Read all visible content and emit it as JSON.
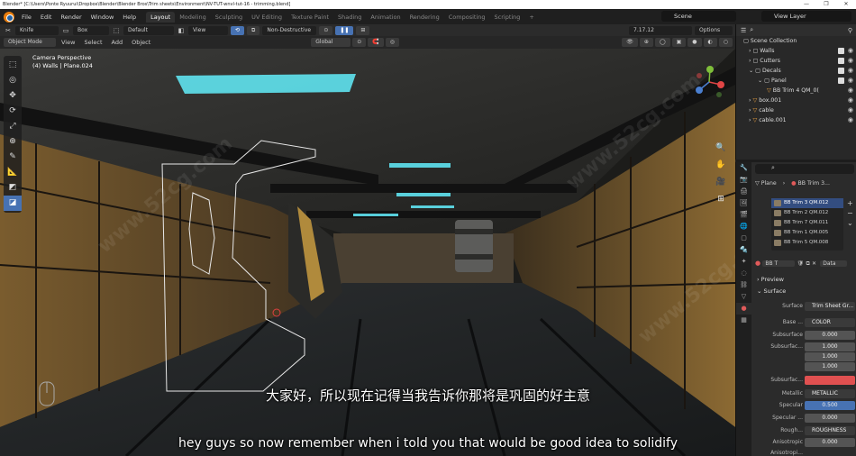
{
  "window": {
    "title": "Blender* [C:\\Users\\Ponte Ryuurui\\Dropbox\\Blender\\Blender Bros\\Trim sheets\\Environment\\NV-TUT-wnvl-tut-16 - trimming.blend]",
    "controls": [
      "—",
      "❐",
      "✕"
    ]
  },
  "topbar": {
    "menus": [
      "File",
      "Edit",
      "Render",
      "Window",
      "Help"
    ],
    "workspaces": [
      "Layout",
      "Modeling",
      "Sculpting",
      "UV Editing",
      "Texture Paint",
      "Shading",
      "Animation",
      "Rendering",
      "Compositing",
      "Scripting",
      "+"
    ],
    "active_workspace": "Layout",
    "scene": "Scene",
    "view_layer": "View Layer"
  },
  "tool_header": {
    "tool_name": "Knife",
    "shape": "Box",
    "mode_a": "Default",
    "view": "View",
    "mode_b": "Non-Destructive",
    "version": "7.17.12",
    "options": "Options"
  },
  "viewport_header": {
    "mode": "Object Mode",
    "menus": [
      "View",
      "Select",
      "Add",
      "Object"
    ],
    "orientation": "Global"
  },
  "viewport": {
    "camera": "Camera Perspective",
    "object": "(4) Walls | Plane.024",
    "watermarks": [
      "www.52cg.com",
      "www.52cg.com",
      "www.52cg.com"
    ]
  },
  "subtitles": {
    "cn": "大家好，所以现在记得当我告诉你那将是巩固的好主意",
    "en": "hey guys so now remember when i told you that would be good idea to solidify"
  },
  "outliner": {
    "rows": [
      {
        "label": "Scene Collection",
        "indent": 0
      },
      {
        "label": "Walls",
        "indent": 1
      },
      {
        "label": "Cutters",
        "indent": 1
      },
      {
        "label": "Decals",
        "indent": 1
      },
      {
        "label": "Panel",
        "indent": 2
      },
      {
        "label": "BB Trim 4 QM_0(",
        "indent": 3
      },
      {
        "label": "box.001",
        "indent": 1
      },
      {
        "label": "cable",
        "indent": 1
      },
      {
        "label": "cable.001",
        "indent": 1
      }
    ]
  },
  "properties": {
    "object": "Plane",
    "material": "BB Trim 3...",
    "slots": [
      "BB Trim 3 QM.012",
      "BB Trim 2 QM.012",
      "BB Trim 7 QM.011",
      "BB Trim 1 QM.005",
      "BB Trim 5 QM.008"
    ],
    "material_field": "BB T",
    "data": "Data",
    "preview": "Preview",
    "surface_section": "Surface",
    "surface_label": "Surface",
    "surface_value": "Trim Sheet Gr...",
    "base_label": "Base ...",
    "base_value": "COLOR",
    "subsurface_label": "Subsurface",
    "subsurface_value": "0.000",
    "subsurface_r_label": "Subsurfac...",
    "subsurface_r": [
      "1.000",
      "1.000",
      "1.000"
    ],
    "subsurface_c_label": "Subsurfac...",
    "subsurface_color": "#e05050",
    "metallic_label": "Metallic",
    "metallic_value": "METALLIC",
    "specular_label": "Specular",
    "specular_value": "0.500",
    "spec_tint_label": "Specular ...",
    "spec_tint_value": "0.000",
    "rough_label": "Rough...",
    "rough_value": "ROUGHNESS",
    "aniso_label": "Anisotropic",
    "aniso_value": "0.000",
    "aniso_r_label": "Anisotropi..."
  }
}
